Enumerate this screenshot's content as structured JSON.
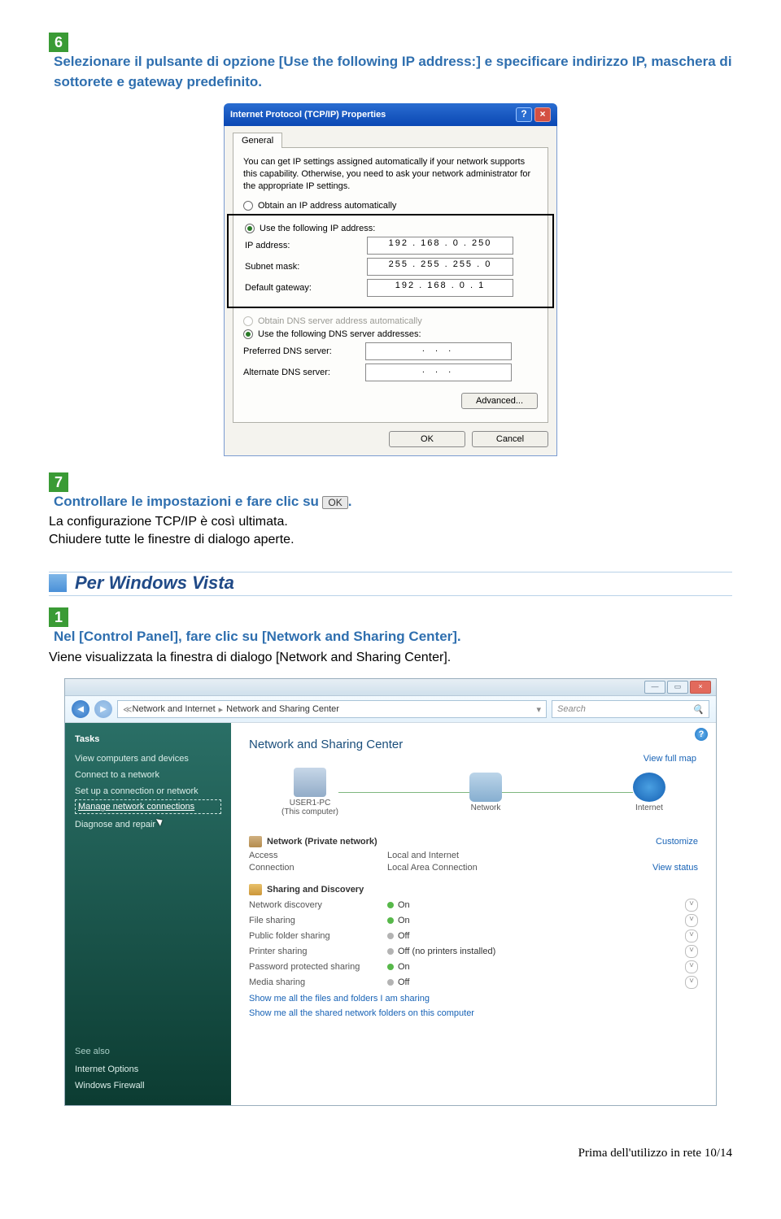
{
  "step6": {
    "num": "6",
    "text": "Selezionare il pulsante di opzione [Use the following IP address:] e specificare indirizzo IP, maschera di sottorete e gateway predefinito."
  },
  "xp": {
    "title": "Internet Protocol (TCP/IP) Properties",
    "tab": "General",
    "info": "You can get IP settings assigned automatically if your network supports this capability. Otherwise, you need to ask your network administrator for the appropriate IP settings.",
    "r_auto_ip": "Obtain an IP address automatically",
    "r_use_ip": "Use the following IP address:",
    "ip_lbl": "IP address:",
    "ip_val": "192 . 168 .   0  . 250",
    "mask_lbl": "Subnet mask:",
    "mask_val": "255 . 255 . 255 .   0",
    "gw_lbl": "Default gateway:",
    "gw_val": "192 . 168 .   0  .   1",
    "r_auto_dns": "Obtain DNS server address automatically",
    "r_use_dns": "Use the following DNS server addresses:",
    "pdns_lbl": "Preferred DNS server:",
    "adns_lbl": "Alternate DNS server:",
    "dns_empty": ".     .     .",
    "adv": "Advanced...",
    "ok": "OK",
    "cancel": "Cancel"
  },
  "step7": {
    "num": "7",
    "text_a": "Controllare le impostazioni e fare clic su",
    "btn": "OK",
    "text_b": ".",
    "line2": "La configurazione TCP/IP è così ultimata.",
    "line3": "Chiudere tutte le finestre di dialogo aperte."
  },
  "section": {
    "title": "Per Windows Vista"
  },
  "step1": {
    "num": "1",
    "text": "Nel [Control Panel], fare clic su [Network and Sharing Center].",
    "line2": "Viene visualizzata la finestra di dialogo [Network and Sharing Center]."
  },
  "vista": {
    "crumb1": "Network and Internet",
    "crumb2": "Network and Sharing Center",
    "search": "Search",
    "tasks": "Tasks",
    "t1": "View computers and devices",
    "t2": "Connect to a network",
    "t3": "Set up a connection or network",
    "t4": "Manage network connections",
    "t5": "Diagnose and repair",
    "see_also": "See also",
    "s1": "Internet Options",
    "s2": "Windows Firewall",
    "main_title": "Network and Sharing Center",
    "view_map": "View full map",
    "node1": "USER1-PC",
    "node1b": "(This computer)",
    "node2": "Network",
    "node3": "Internet",
    "grp_net": "Network (Private network)",
    "customize": "Customize",
    "k_access": "Access",
    "v_access": "Local and Internet",
    "k_conn": "Connection",
    "v_conn": "Local Area Connection",
    "view_status": "View status",
    "grp_share": "Sharing and Discovery",
    "sh": [
      {
        "k": "Network discovery",
        "on": true,
        "v": "On"
      },
      {
        "k": "File sharing",
        "on": true,
        "v": "On"
      },
      {
        "k": "Public folder sharing",
        "on": false,
        "v": "Off"
      },
      {
        "k": "Printer sharing",
        "on": false,
        "v": "Off (no printers installed)"
      },
      {
        "k": "Password protected sharing",
        "on": true,
        "v": "On"
      },
      {
        "k": "Media sharing",
        "on": false,
        "v": "Off"
      }
    ],
    "show1": "Show me all the files and folders I am sharing",
    "show2": "Show me all the shared network folders on this computer"
  },
  "footer": "Prima dell'utilizzo in rete 10/14"
}
